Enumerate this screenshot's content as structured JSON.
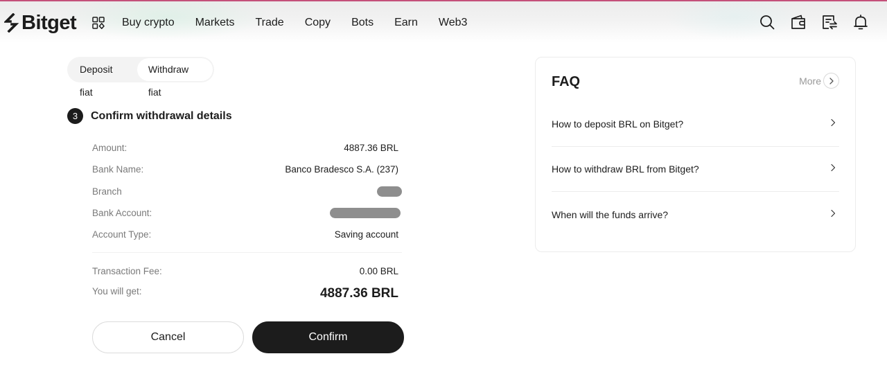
{
  "header": {
    "brand": "Bitget",
    "nav": [
      "Buy crypto",
      "Markets",
      "Trade",
      "Copy",
      "Bots",
      "Earn",
      "Web3"
    ],
    "icons": [
      "search-icon",
      "wallet-icon",
      "orders-icon",
      "bell-icon"
    ]
  },
  "tabs": {
    "items": [
      {
        "label": "Deposit fiat",
        "active": false
      },
      {
        "label": "Withdraw fiat",
        "active": true
      }
    ]
  },
  "step": {
    "number": "3",
    "title": "Confirm withdrawal details"
  },
  "details": {
    "rows": [
      {
        "label": "Amount:",
        "value": "4887.36 BRL"
      },
      {
        "label": "Bank Name:",
        "value": "Banco Bradesco S.A. (237)"
      },
      {
        "label": "Branch",
        "value": null,
        "masked": true
      },
      {
        "label": "Bank Account:",
        "value": null,
        "masked": true
      },
      {
        "label": "Account Type:",
        "value": "Saving account"
      }
    ],
    "fee": {
      "label": "Transaction Fee:",
      "value": "0.00 BRL"
    },
    "receive": {
      "label": "You will get:",
      "value": "4887.36 BRL"
    }
  },
  "actions": {
    "cancel_label": "Cancel",
    "confirm_label": "Confirm"
  },
  "faq": {
    "title": "FAQ",
    "more_label": "More",
    "items": [
      "How to deposit BRL on Bitget?",
      "How to withdraw BRL from Bitget?",
      "When will the funds arrive?"
    ]
  }
}
